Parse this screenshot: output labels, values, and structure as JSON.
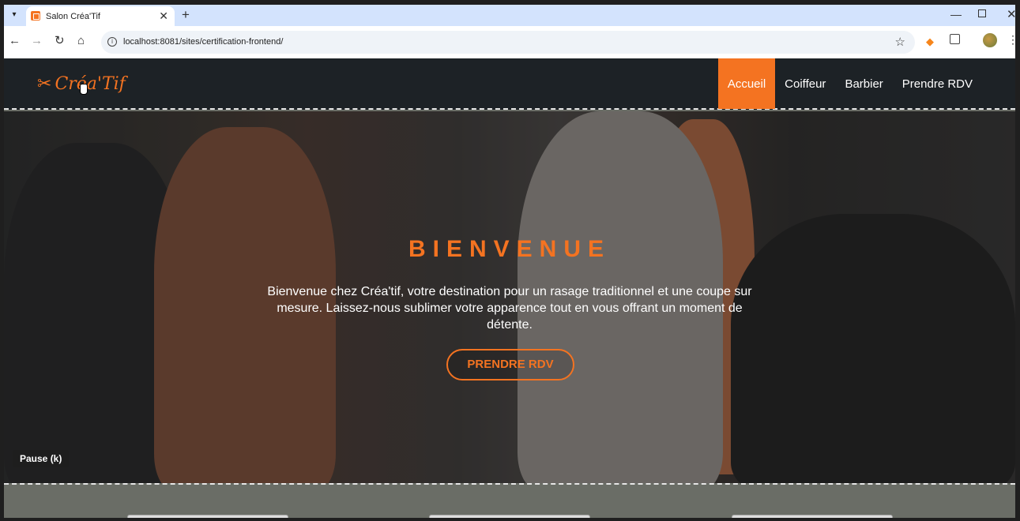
{
  "browser": {
    "tab_title": "Salon Créa'Tif",
    "tab_close": "✕",
    "new_tab": "+",
    "url": "localhost:8081/sites/certification-frontend/",
    "win_min": "—",
    "win_close": "✕"
  },
  "site": {
    "logo_text": "Créa'Tif",
    "logo_icon": "✂",
    "nav": [
      "Accueil",
      "Coiffeur",
      "Barbier",
      "Prendre RDV"
    ],
    "active_nav": "Accueil",
    "accent_color": "#f47321"
  },
  "hero": {
    "title": "BIENVENUE",
    "text": "Bienvenue chez Créa'tif, votre destination pour un rasage traditionnel et une coupe sur mesure. Laissez-nous sublimer votre apparence tout en vous offrant un moment de détente.",
    "button": "PRENDRE RDV",
    "pause_label": "Pause (k)"
  },
  "icons": {
    "back": "←",
    "forward": "→",
    "reload": "↻",
    "home": "⌂",
    "star": "☆",
    "dots": "⋮",
    "info": "i"
  }
}
